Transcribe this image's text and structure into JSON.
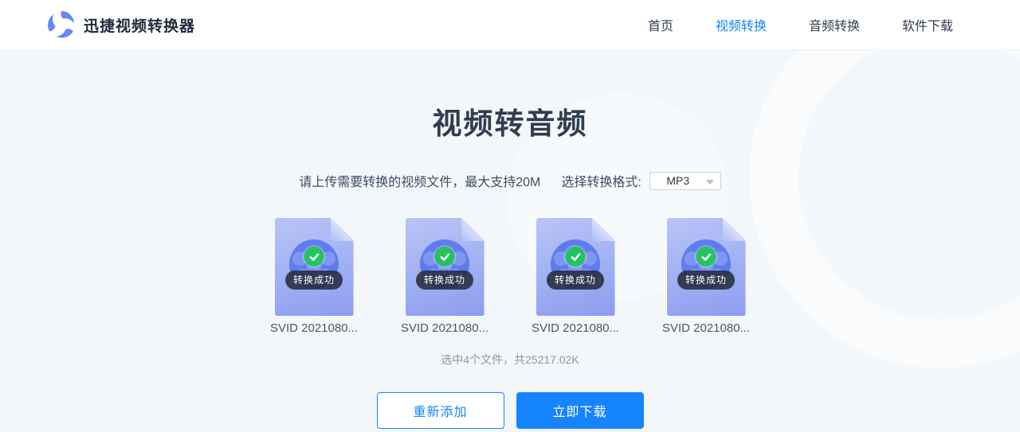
{
  "brand": {
    "name": "迅捷视频转换器"
  },
  "nav": {
    "items": [
      {
        "label": "首页",
        "active": false
      },
      {
        "label": "视频转换",
        "active": true
      },
      {
        "label": "音频转换",
        "active": false
      },
      {
        "label": "软件下载",
        "active": false
      }
    ]
  },
  "hero": {
    "title": "视频转音频",
    "upload_hint": "请上传需要转换的视频文件，最大支持20M",
    "format_label": "选择转换格式:",
    "format_value": "MP3"
  },
  "files": [
    {
      "name": "SVID 2021080...",
      "status": "转换成功"
    },
    {
      "name": "SVID 2021080...",
      "status": "转换成功"
    },
    {
      "name": "SVID 2021080...",
      "status": "转换成功"
    },
    {
      "name": "SVID 2021080...",
      "status": "转换成功"
    }
  ],
  "summary_text": "选中4个文件，共25217.02K",
  "actions": {
    "re_add_label": "重新添加",
    "download_label": "立即下载"
  },
  "colors": {
    "accent": "#1684fc",
    "success_green": "#25c35f",
    "doc_blue": "#8d9df0",
    "page_bg": "#f3f7fa"
  }
}
